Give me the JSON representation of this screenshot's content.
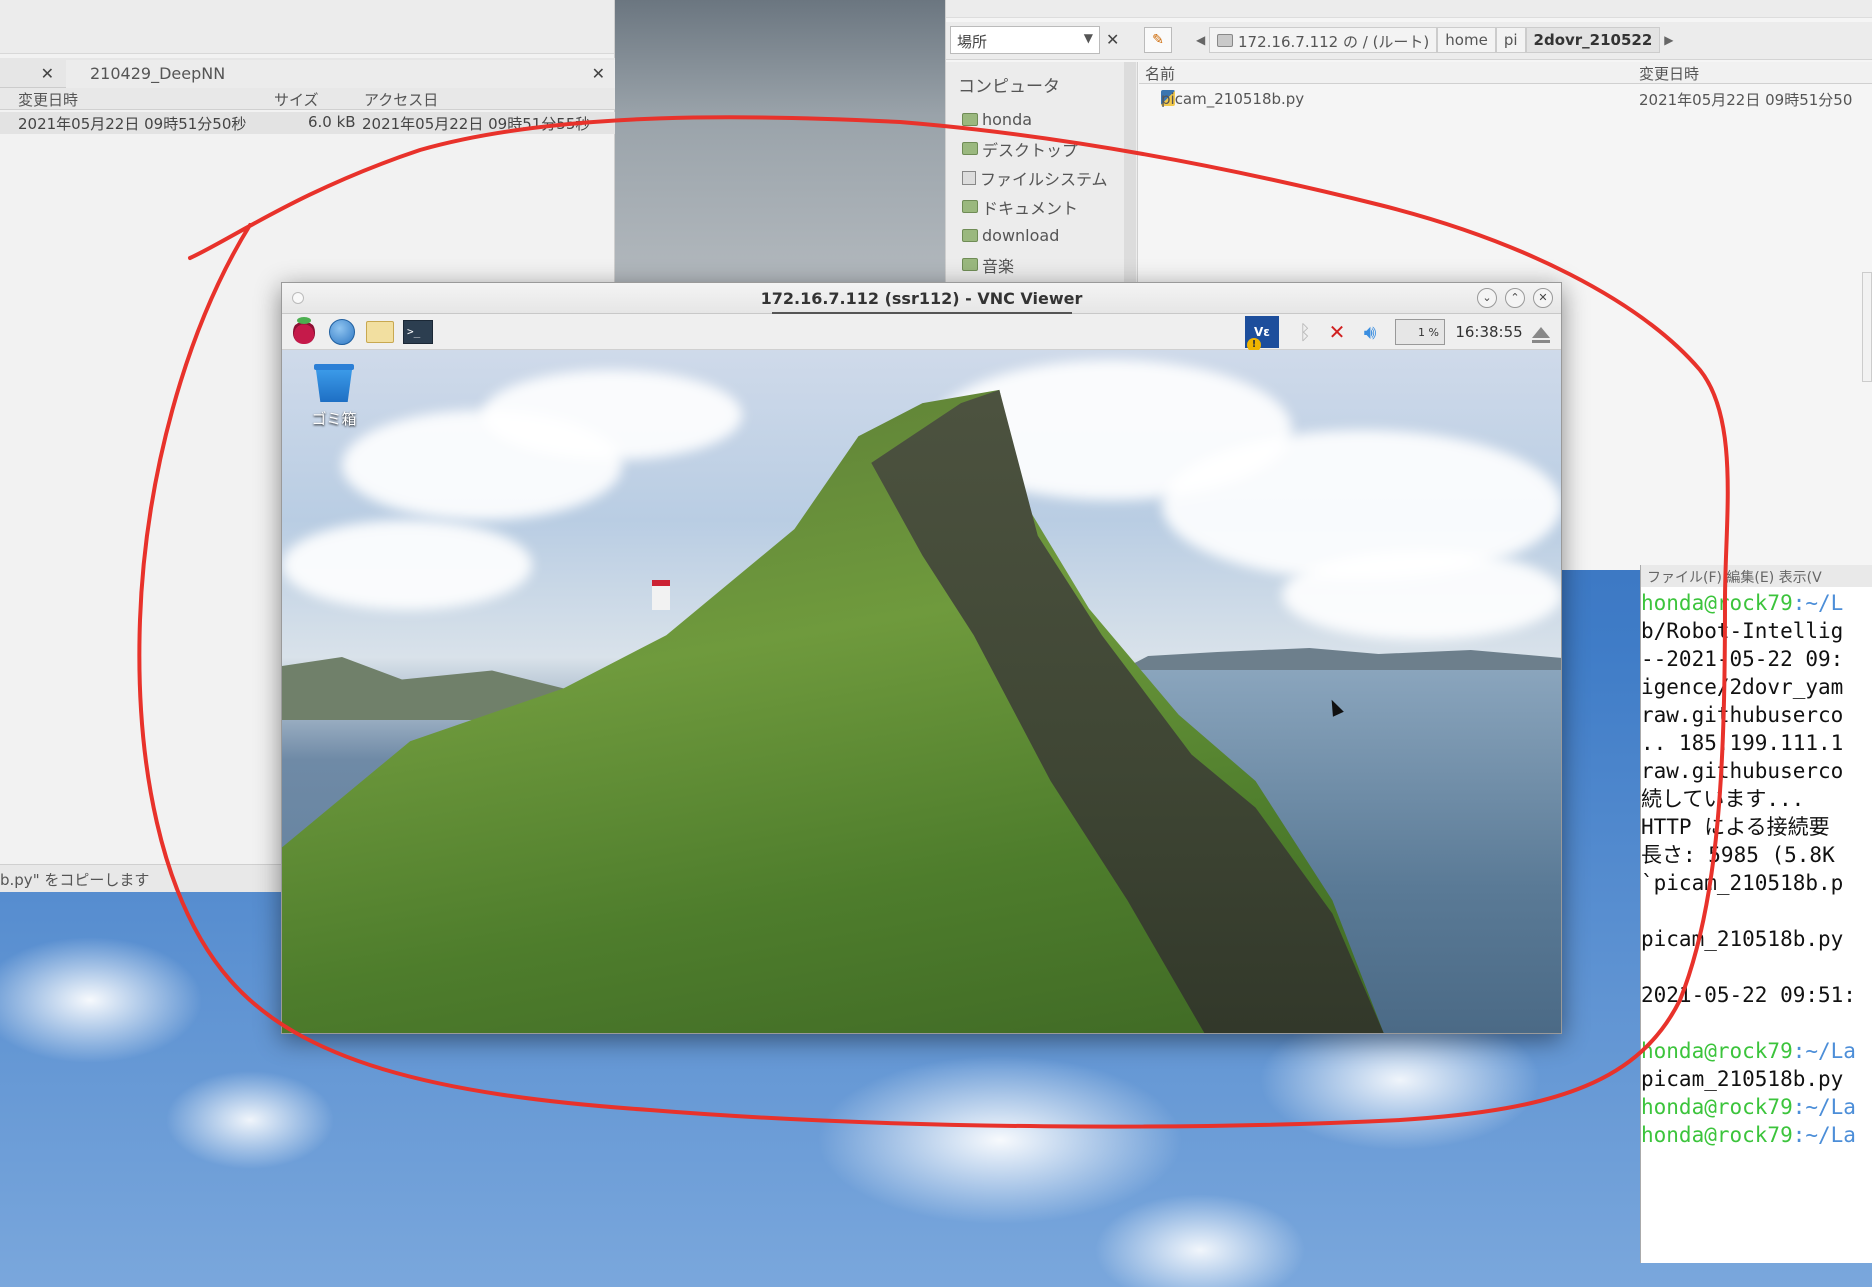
{
  "left_fm": {
    "tabs": [
      {
        "label": ""
      },
      {
        "label": "210429_DeepNN"
      }
    ],
    "columns": [
      "変更日時",
      "サイズ",
      "アクセス日"
    ],
    "row": {
      "modified": "2021年05月22日 09時51分50秒",
      "size": "6.0 kB",
      "accessed": "2021年05月22日 09時51分55秒"
    },
    "status": "b.py\" をコピーします"
  },
  "right_fm": {
    "place_label": "場所",
    "location_crumbs": [
      "172.16.7.112 の / (ルート)",
      "home",
      "pi",
      "2dovr_210522"
    ],
    "sidebar_title": "コンピュータ",
    "sidebar_items": [
      "honda",
      "デスクトップ",
      "ファイルシステム",
      "ドキュメント",
      "download",
      "音楽"
    ],
    "columns": [
      "名前",
      "変更日時"
    ],
    "files": [
      {
        "name": "picam_210518b.py",
        "modified": "2021年05月22日 09時51分50"
      }
    ]
  },
  "vnc": {
    "title": "172.16.7.112 (ssr112) - VNC Viewer",
    "cpu": "1 %",
    "clock": "16:38:55",
    "trash_label": "ゴミ箱",
    "icons": [
      "raspberry-pi-menu-icon",
      "web-browser-icon",
      "file-manager-icon",
      "terminal-icon",
      "vnc-server-icon",
      "bluetooth-icon",
      "network-disconnected-icon",
      "volume-icon",
      "eject-icon"
    ]
  },
  "terminal": {
    "menu": "ファイル(F)  編集(E)  表示(V",
    "lines": [
      {
        "user": "honda@rock79",
        "path": ":~/L",
        "text": ""
      },
      {
        "text": "b/Robot-Intellig"
      },
      {
        "text": "--2021-05-22 09:"
      },
      {
        "text": "igence/2dovr_yam"
      },
      {
        "text": "raw.githubuserco"
      },
      {
        "text": ".. 185.199.111.1"
      },
      {
        "text": "raw.githubuserco"
      },
      {
        "text": "続しています..."
      },
      {
        "text": "HTTP による接続要"
      },
      {
        "text": "長さ: 5985 (5.8K"
      },
      {
        "text": "`picam_210518b.p"
      },
      {
        "text": ""
      },
      {
        "text": "picam_210518b.py"
      },
      {
        "text": ""
      },
      {
        "text": "2021-05-22 09:51:"
      },
      {
        "text": ""
      },
      {
        "user": "honda@rock79",
        "path": ":~/La",
        "text": ""
      },
      {
        "text": "picam_210518b.py"
      },
      {
        "user": "honda@rock79",
        "path": ":~/La",
        "text": ""
      },
      {
        "user": "honda@rock79",
        "path": ":~/La",
        "text": ""
      }
    ]
  },
  "colors": {
    "annotation": "#e8322b",
    "terminal_user": "#3cc43c",
    "terminal_path": "#4c8ed8"
  }
}
